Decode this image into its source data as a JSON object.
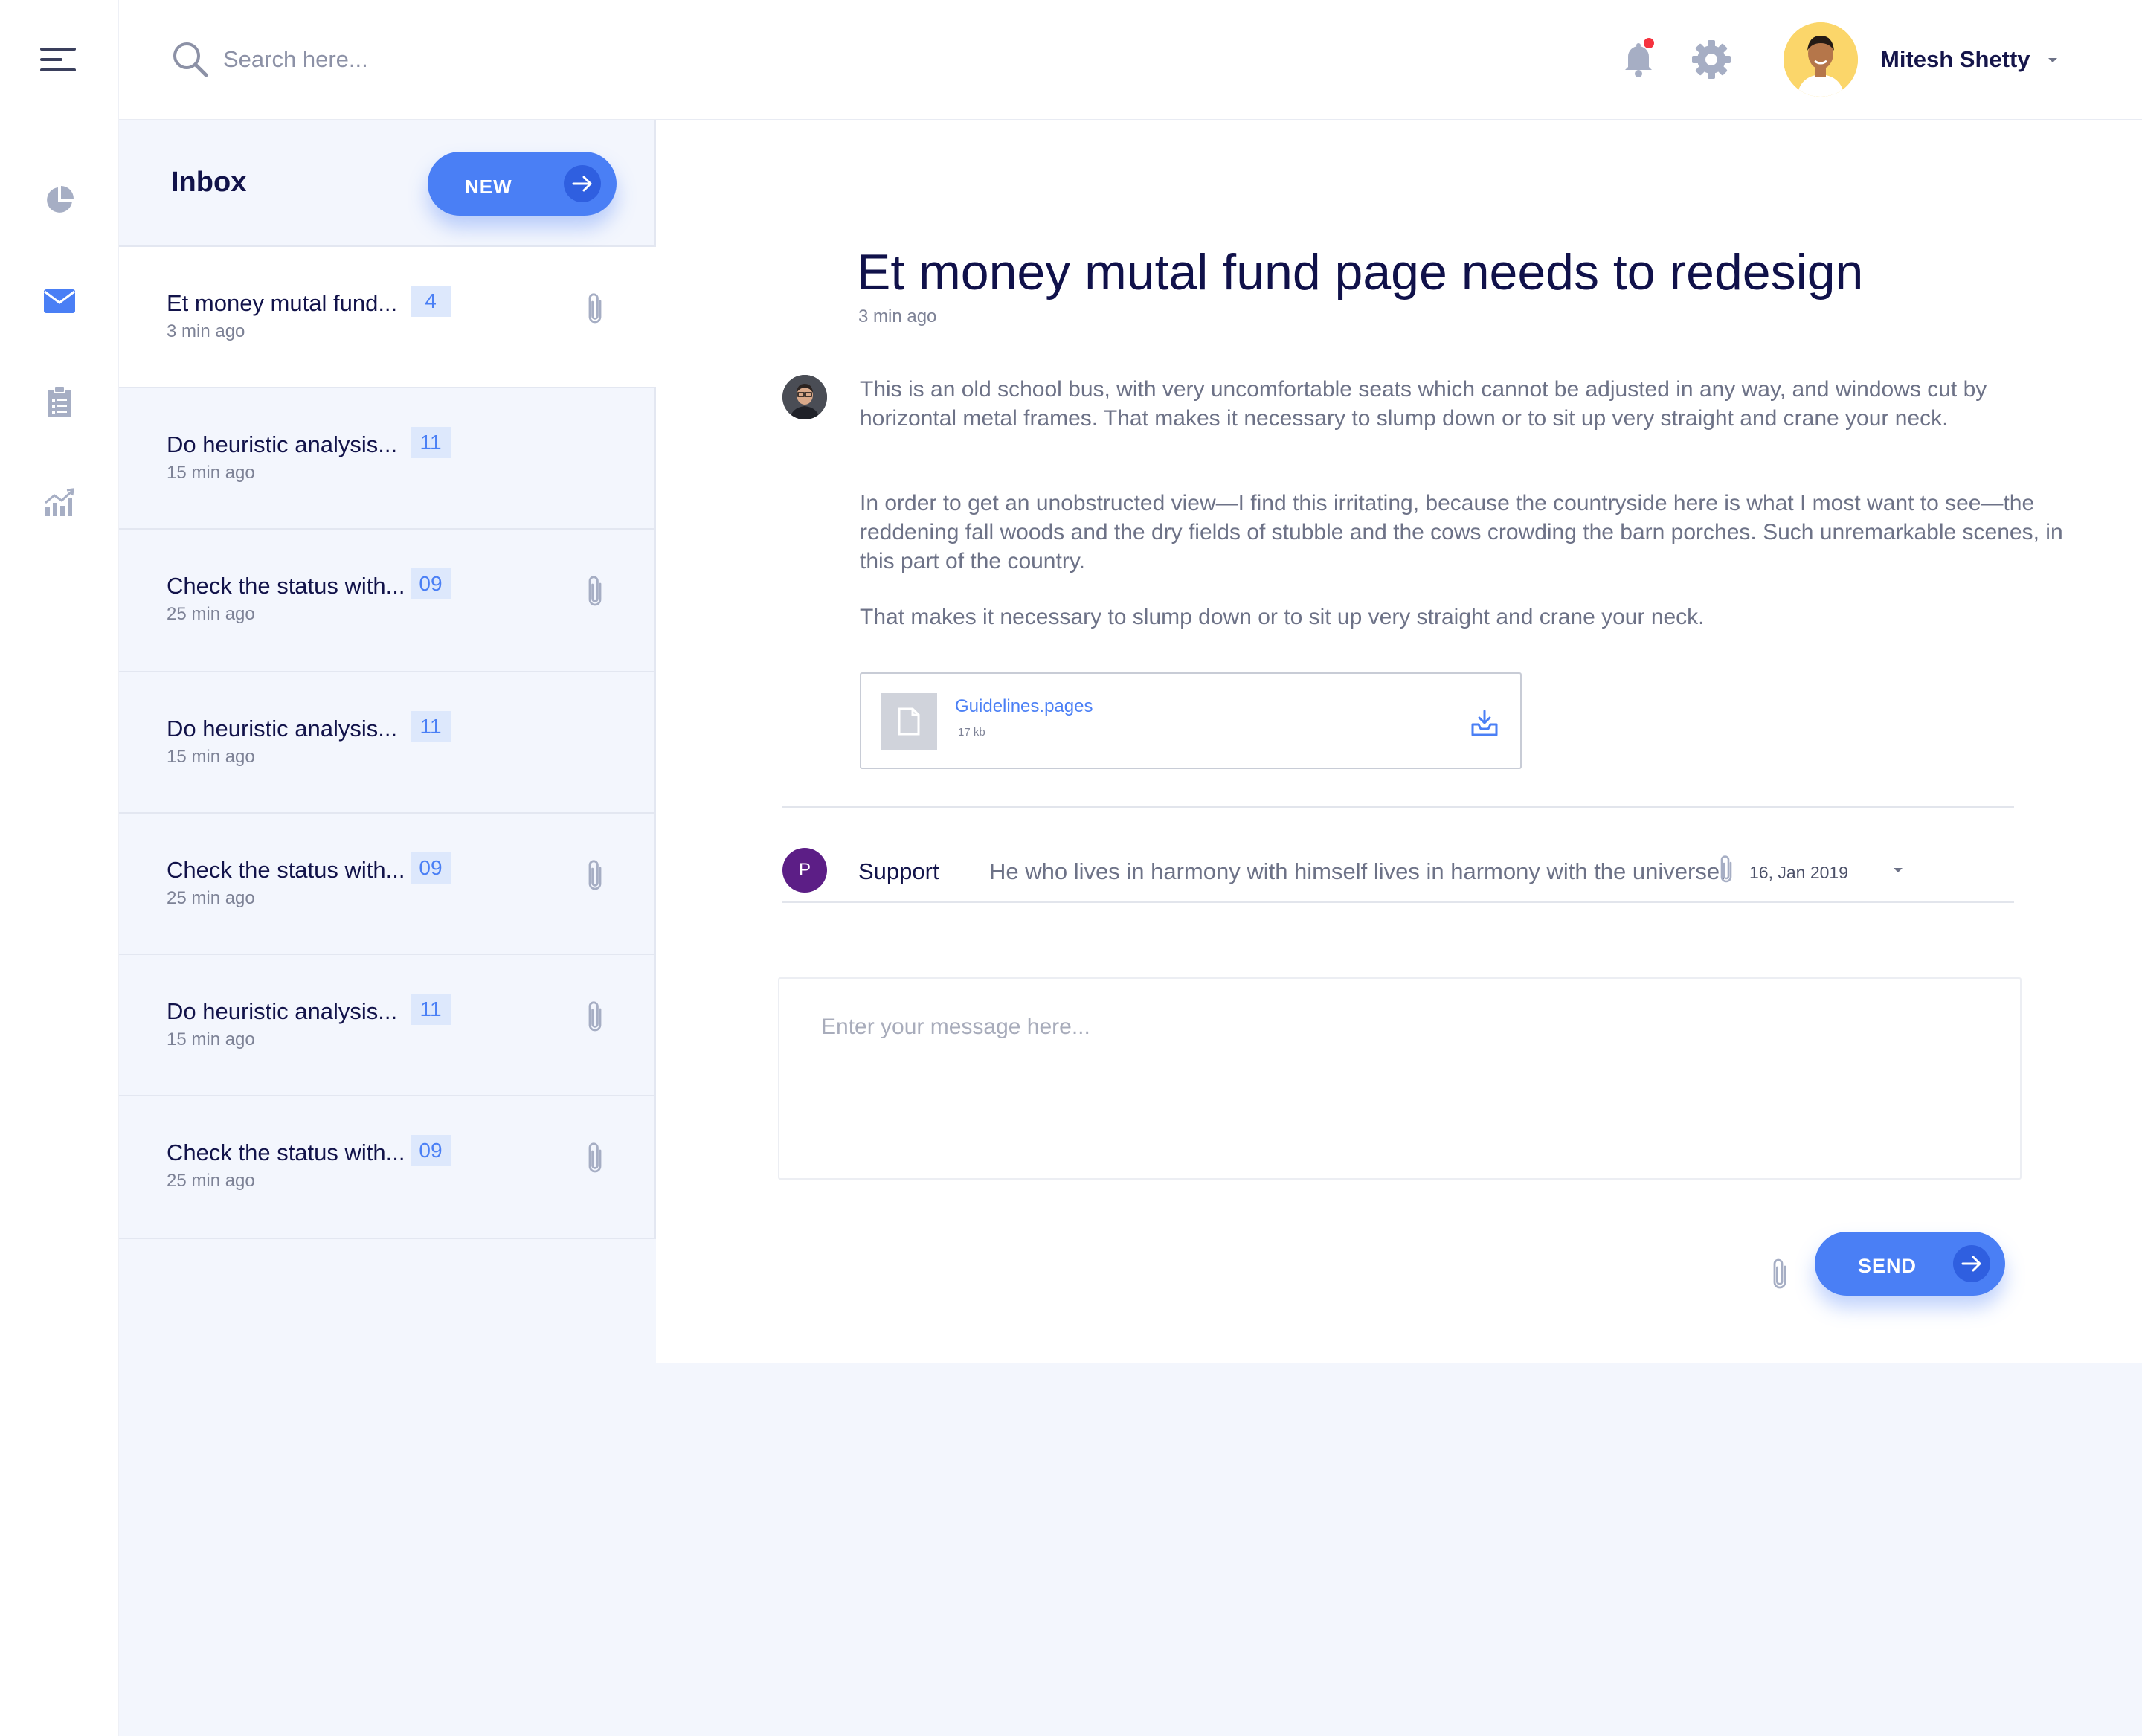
{
  "colors": {
    "accent": "#4a7ff5",
    "accent_dark": "#2f5fe0",
    "heading": "#12134a",
    "muted": "#7d8296",
    "panel_bg": "#f3f6fd",
    "badge_bg": "#dde8fc",
    "notification_dot": "#f5333f",
    "reply_avatar": "#5c1e86"
  },
  "sidebar": {
    "items": [
      {
        "icon": "menu-icon"
      },
      {
        "icon": "pie-chart-icon"
      },
      {
        "icon": "mail-icon",
        "active": true
      },
      {
        "icon": "clipboard-icon"
      },
      {
        "icon": "analytics-icon"
      }
    ]
  },
  "header": {
    "search_placeholder": "Search here...",
    "notification_icon": "bell-icon",
    "settings_icon": "gear-icon",
    "user_name": "Mitesh Shetty"
  },
  "inbox": {
    "title": "Inbox",
    "new_button": "NEW",
    "items": [
      {
        "subject": "Et money mutal fund...",
        "time": "3 min ago",
        "count": "4",
        "attachment": true,
        "active": true
      },
      {
        "subject": "Do heuristic analysis...",
        "time": "15 min ago",
        "count": "11",
        "attachment": false
      },
      {
        "subject": "Check the status with...",
        "time": "25 min ago",
        "count": "09",
        "attachment": true
      },
      {
        "subject": "Do heuristic analysis...",
        "time": "15 min ago",
        "count": "11",
        "attachment": false
      },
      {
        "subject": "Check the status with...",
        "time": "25 min ago",
        "count": "09",
        "attachment": true
      },
      {
        "subject": "Do heuristic analysis...",
        "time": "15 min ago",
        "count": "11",
        "attachment": true
      },
      {
        "subject": "Check the status with...",
        "time": "25 min ago",
        "count": "09",
        "attachment": true
      }
    ]
  },
  "message": {
    "title": "Et money mutal fund page needs to redesign",
    "time": "3 min ago",
    "paragraphs": [
      "This is an old school bus, with very uncomfortable seats which cannot be adjusted in any way, and windows cut by horizontal metal frames. That makes it necessary to slump down or to sit up very straight and crane your neck.",
      "In order to get an unobstructed view—I find this irritating, because the countryside here is what I most want to see—the reddening fall woods and the dry fields of stubble and the cows crowding the barn porches. Such unremarkable scenes, in this part of the country.",
      "That makes it necessary to slump down or to sit up very straight and crane your neck."
    ],
    "attachment": {
      "name": "Guidelines.pages",
      "size": "17 kb"
    }
  },
  "reply": {
    "avatar_letter": "P",
    "sender": "Support",
    "preview": "He who lives in harmony with himself lives in harmony with the universe.",
    "date": "16, Jan 2019"
  },
  "composer": {
    "placeholder": "Enter your message here...",
    "send_button": "SEND"
  }
}
